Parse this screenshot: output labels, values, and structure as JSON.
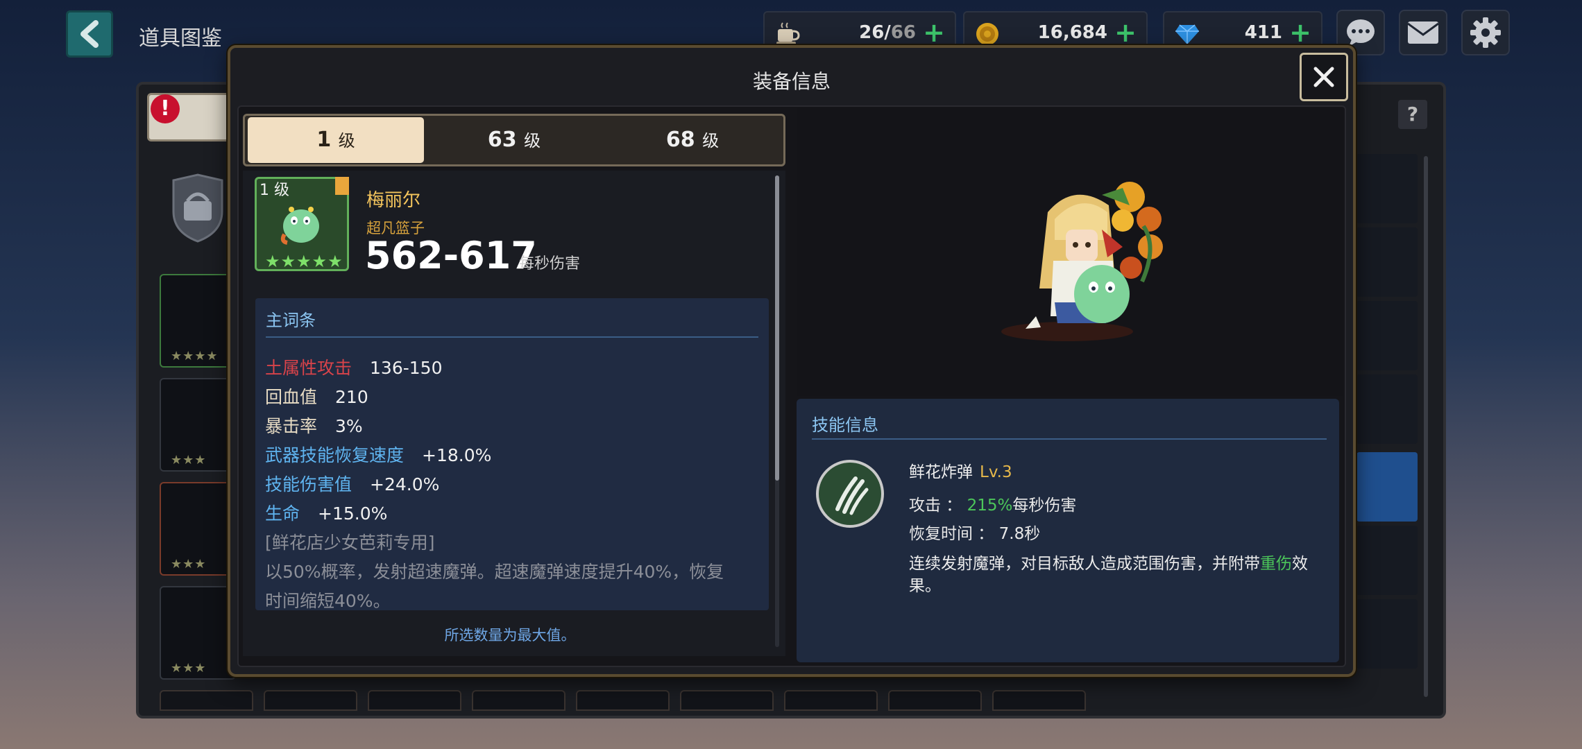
{
  "header": {
    "title": "道具图鉴",
    "resources": [
      {
        "icon": "coffee-icon",
        "value_main": "26/",
        "value_dim": "66"
      },
      {
        "icon": "gold-coin-icon",
        "value_main": "16,684",
        "value_dim": ""
      },
      {
        "icon": "gem-icon",
        "value_main": "411",
        "value_dim": ""
      }
    ]
  },
  "modal": {
    "title": "装备信息",
    "tabs": [
      {
        "level": "1",
        "unit": "级",
        "active": true
      },
      {
        "level": "63",
        "unit": "级",
        "active": false
      },
      {
        "level": "68",
        "unit": "级",
        "active": false
      }
    ],
    "item": {
      "level_label": "1 级",
      "star_count": 5,
      "name": "梅丽尔",
      "subtitle": "超凡篮子",
      "damage": "562-617",
      "damage_unit": "每秒伤害"
    },
    "stats": {
      "heading": "主词条",
      "rows": [
        {
          "label": "土属性攻击",
          "value": "136-150",
          "tone": "red"
        },
        {
          "label": "回血值",
          "value": "210",
          "tone": "tan"
        },
        {
          "label": "暴击率",
          "value": "3%",
          "tone": "tan"
        },
        {
          "label": "武器技能恢复速度",
          "value": "+18.0%",
          "tone": "blue"
        },
        {
          "label": "技能伤害值",
          "value": "+24.0%",
          "tone": "blue"
        },
        {
          "label": "生命",
          "value": "+15.0%",
          "tone": "blue"
        }
      ],
      "exclusive": "[鲜花店少女芭莉专用]",
      "exclusive_desc_1": "以50%概率，发射超速魔弹。超速魔弹速度提升40%，恢复",
      "exclusive_desc_2": "时间缩短40%。"
    },
    "max_note": "所选数量为最大值。",
    "skill": {
      "heading": "技能信息",
      "name": "鲜花炸弹",
      "level": "Lv.3",
      "attack_label": "攻击 ：",
      "attack_pct": "215%",
      "attack_unit": "每秒伤害",
      "cooldown_label": "恢复时间 ：",
      "cooldown_value": "7.8秒",
      "desc_before": "连续发射魔弹，对目标敌人造成范围伤害，并附带",
      "desc_highlight": "重伤",
      "desc_after": "效果。"
    }
  },
  "colors": {
    "modal_border": "#5a4b30",
    "tab_active": "#f2dfc2",
    "name_gold": "#f3c45c",
    "stat_red": "#d9434a",
    "stat_blue": "#5fb4f0",
    "highlight_green": "#4cc65a",
    "resource_plus": "#3dc36b"
  }
}
